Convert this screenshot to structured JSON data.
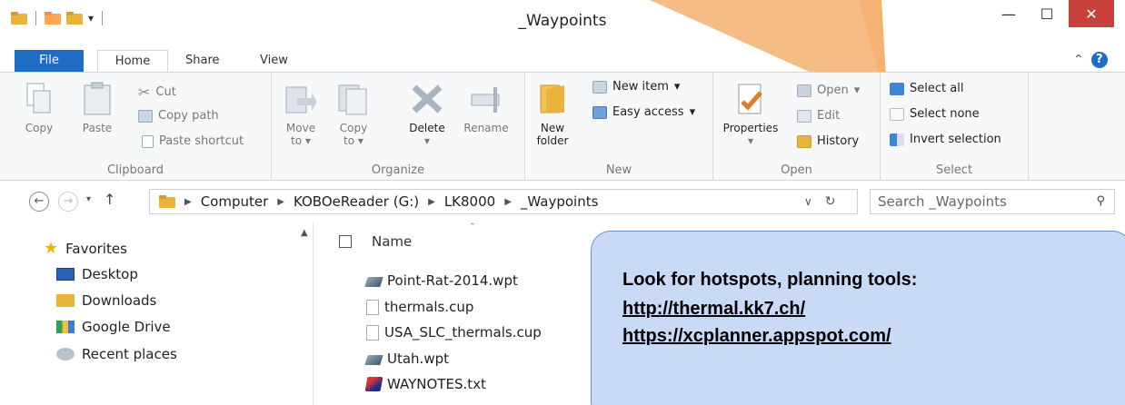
{
  "window": {
    "title": "_Waypoints"
  },
  "ribbon_tabs": [
    {
      "label": "File"
    },
    {
      "label": "Home"
    },
    {
      "label": "Share"
    },
    {
      "label": "View"
    }
  ],
  "ribbon": {
    "clipboard": {
      "label": "Clipboard",
      "copy": "Copy",
      "paste": "Paste",
      "cut": "Cut",
      "copy_path": "Copy path",
      "paste_shortcut": "Paste shortcut"
    },
    "organize": {
      "label": "Organize",
      "move_to_1": "Move",
      "move_to_2": "to",
      "copy_to_1": "Copy",
      "copy_to_2": "to",
      "delete": "Delete",
      "rename": "Rename"
    },
    "new": {
      "label": "New",
      "new_folder_1": "New",
      "new_folder_2": "folder",
      "new_item": "New item",
      "easy_access": "Easy access"
    },
    "open": {
      "label": "Open",
      "properties": "Properties",
      "open": "Open",
      "edit": "Edit",
      "history": "History"
    },
    "select": {
      "label": "Select",
      "select_all": "Select all",
      "select_none": "Select none",
      "invert_selection": "Invert selection"
    }
  },
  "address": {
    "crumbs": [
      "Computer",
      "KOBOeReader (G:)",
      "LK8000",
      "_Waypoints"
    ],
    "search_placeholder": "Search _Waypoints"
  },
  "nav_pane": {
    "items": [
      {
        "label": "Favorites"
      },
      {
        "label": "Desktop"
      },
      {
        "label": "Downloads"
      },
      {
        "label": "Google Drive"
      },
      {
        "label": "Recent places"
      }
    ]
  },
  "file_list": {
    "column_name": "Name",
    "files": [
      {
        "name": "Point-Rat-2014.wpt"
      },
      {
        "name": "thermals.cup"
      },
      {
        "name": "USA_SLC_thermals.cup"
      },
      {
        "name": "Utah.wpt"
      },
      {
        "name": "WAYNOTES.txt"
      }
    ]
  },
  "annotation": {
    "title": "Look for hotspots, planning tools:",
    "link1": "http://thermal.kk7.ch/",
    "link2": "https://xcplanner.appspot.com/"
  },
  "colors": {
    "accent_blue": "#1e6ec8",
    "close_red": "#c7403a",
    "folder_yellow": "#e8b43c",
    "callout_orange": "#f5b070",
    "note_blue": "#c8daf5"
  }
}
